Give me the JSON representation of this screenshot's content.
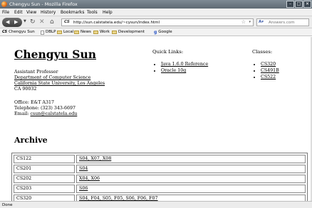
{
  "window": {
    "title": "Chengyu Sun - Mozilla Firefox"
  },
  "menu": [
    "File",
    "Edit",
    "View",
    "History",
    "Bookmarks",
    "Tools",
    "Help"
  ],
  "navbar": {
    "url": "http://sun.calstatela.edu/~cysun/index.html",
    "site_icon": "CS",
    "search_placeholder": "Answers.com"
  },
  "bookmarks": [
    "Chengyu Sun",
    "DBLP",
    "Local",
    "News",
    "Work",
    "Development",
    "Google"
  ],
  "profile": {
    "name": "Chengyu Sun",
    "position": "Assistant Professor",
    "department": "Department of Computer Science",
    "university": "California State University, Los Angeles",
    "city": "CA 90032",
    "office": "Office: E&T A317",
    "telephone": "Telephone:  (323) 343-6697",
    "email_label": "Email: ",
    "email": "csun@calstatela.edu"
  },
  "quick_links": {
    "title": "Quick Links:",
    "items": [
      "Java 1.6.0 Reference",
      "Oracle 10g"
    ]
  },
  "classes": {
    "title": "Classes:",
    "items": [
      "CS320",
      "CS491B",
      "CS522"
    ]
  },
  "archive": {
    "title": "Archive",
    "rows": [
      {
        "course": "CS122",
        "terms": "S04, X07, X08"
      },
      {
        "course": "CS201",
        "terms": "S04"
      },
      {
        "course": "CS202",
        "terms": "X04, X06"
      },
      {
        "course": "CS203",
        "terms": "S06"
      },
      {
        "course": "CS320",
        "terms": "S04, F04, S05, F05, S06, F06, F07"
      }
    ]
  },
  "status": "Done"
}
